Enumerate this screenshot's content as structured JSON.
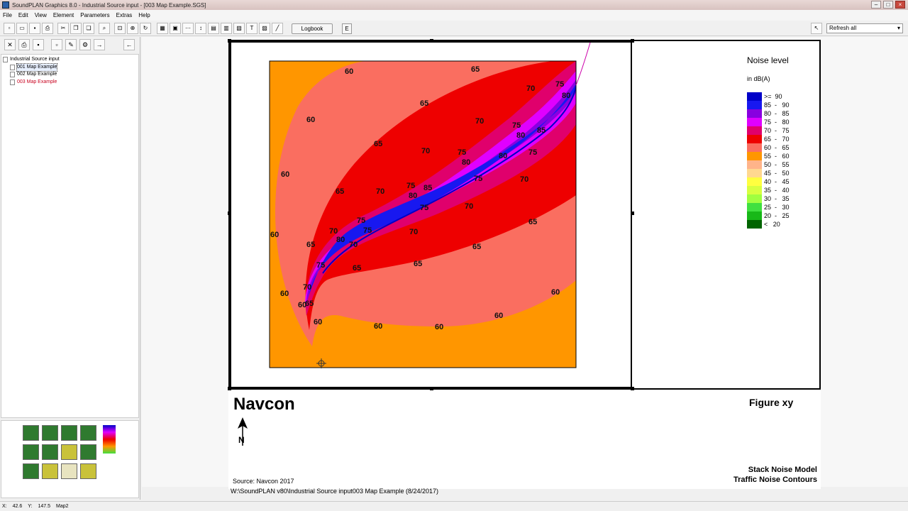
{
  "window": {
    "title": "SoundPLAN Graphics 8.0 - Industrial Source input - [003 Map Example.SGS]"
  },
  "menu": [
    "File",
    "Edit",
    "View",
    "Element",
    "Parameters",
    "Extras",
    "Help"
  ],
  "toolbar": {
    "logbook_label": "Logbook",
    "e_label": "E",
    "refresh_value": "Refresh all"
  },
  "tree": {
    "root": "Industrial Source input",
    "items": [
      "001 Map Example",
      "002 Map Example",
      "003 Map Example"
    ]
  },
  "legend": {
    "title": "Noise level",
    "unit": "in dB(A)",
    "rows": [
      {
        "label": ">=  90",
        "color": "#0000c8"
      },
      {
        "label": "85  -   90",
        "color": "#1818f0"
      },
      {
        "label": "80  -   85",
        "color": "#8800e0"
      },
      {
        "label": "75  -   80",
        "color": "#e000ff"
      },
      {
        "label": "70  -   75",
        "color": "#e0006c"
      },
      {
        "label": "65  -   70",
        "color": "#ee0000"
      },
      {
        "label": "60  -   65",
        "color": "#fa6e60"
      },
      {
        "label": "55  -   60",
        "color": "#ff9600"
      },
      {
        "label": "50  -   55",
        "color": "#ffb48a"
      },
      {
        "label": "45  -   50",
        "color": "#ffd890"
      },
      {
        "label": "40  -   45",
        "color": "#ffff40"
      },
      {
        "label": "35  -   40",
        "color": "#d8ff40"
      },
      {
        "label": "30  -   35",
        "color": "#a0ff40"
      },
      {
        "label": "25  -   30",
        "color": "#40e040"
      },
      {
        "label": "20  -   25",
        "color": "#18b818"
      },
      {
        "label": "<   20",
        "color": "#006400"
      }
    ]
  },
  "map": {
    "contour_labels": [
      "60",
      "65",
      "70",
      "75",
      "80",
      "85"
    ]
  },
  "footer": {
    "company": "Navcon",
    "figure": "Figure xy",
    "north_letter": "N",
    "source": "Source: Navcon 2017",
    "subtitle1": "Stack Noise Model",
    "subtitle2": "Traffic Noise Contours",
    "path": "W:\\SoundPLAN v80\\Industrial Source input003 Map Example (8/24/2017)"
  },
  "status": {
    "x_label": "X:",
    "x_value": "42.6",
    "y_label": "Y:",
    "y_value": "147.5",
    "layer": "Map2"
  }
}
